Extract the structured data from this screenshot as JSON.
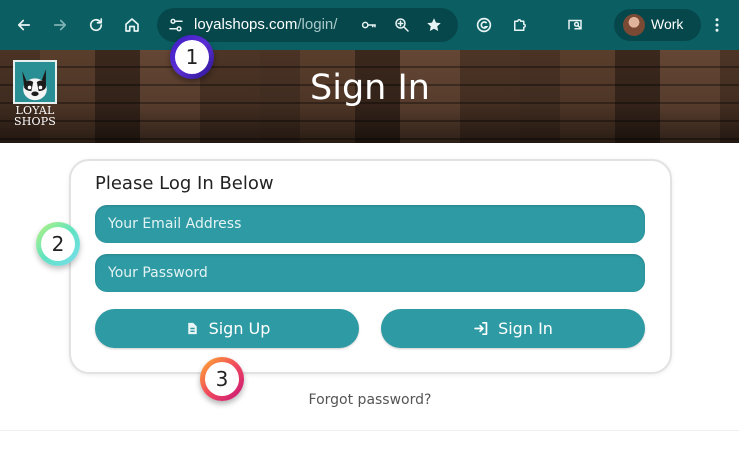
{
  "browser": {
    "url_host": "loyalshops.com",
    "url_path": "/login/",
    "profile_label": "Work",
    "icons": {
      "back": "back-arrow-icon",
      "forward": "forward-arrow-icon",
      "reload": "reload-icon",
      "home": "home-icon",
      "site_info": "tune-icon",
      "passwords": "key-icon",
      "zoom": "zoom-icon",
      "bookmark": "star-icon",
      "grammarly": "grammarly-icon",
      "extensions": "puzzle-icon",
      "cast": "cast-search-icon",
      "menu": "kebab-menu-icon"
    }
  },
  "banner": {
    "logo_line1": "LOYAL",
    "logo_line2": "SHOPS",
    "title": "Sign In"
  },
  "login": {
    "heading": "Please Log In Below",
    "email_placeholder": "Your Email Address",
    "password_placeholder": "Your Password",
    "signup_label": "Sign Up",
    "signin_label": "Sign In",
    "forgot_label": "Forgot password?"
  },
  "annotations": {
    "badge1": "1",
    "badge2": "2",
    "badge3": "3"
  },
  "colors": {
    "toolbar": "#0b5f63",
    "accent": "#2e9aa3",
    "text": "#222222"
  }
}
